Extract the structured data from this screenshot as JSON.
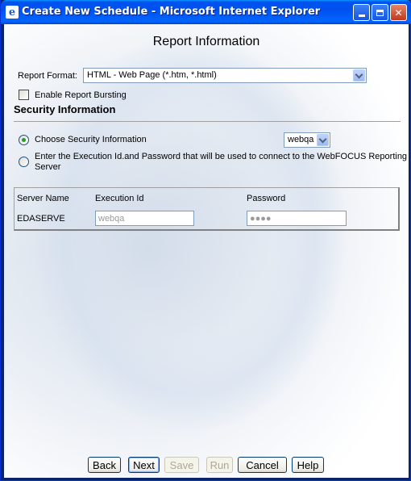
{
  "window": {
    "title": "Create New Schedule - Microsoft Internet Explorer",
    "icon": "ie-page-icon"
  },
  "page": {
    "title": "Report Information"
  },
  "report_format": {
    "label": "Report Format:",
    "value": "HTML - Web Page (*.htm, *.html)"
  },
  "bursting": {
    "label": "Enable Report Bursting",
    "checked": false
  },
  "security": {
    "heading": "Security Information",
    "choose_label": "Choose Security Information",
    "choose_checked": true,
    "choose_value": "webqa",
    "enter_label_line1": "Enter the Execution Id.and Password that will be used to connect to the WebFOCUS Reporting",
    "enter_label_line2": "Server",
    "enter_checked": false
  },
  "server_table": {
    "headers": [
      "Server Name",
      "Execution Id",
      "Password"
    ],
    "row": {
      "server_name": "EDASERVE",
      "execution_id": "webqa",
      "password": "●●●●"
    }
  },
  "buttons": {
    "back": "Back",
    "next": "Next",
    "save": "Save",
    "run": "Run",
    "cancel": "Cancel",
    "help": "Help"
  }
}
